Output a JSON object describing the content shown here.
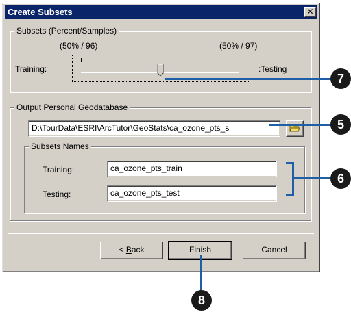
{
  "dialog": {
    "title": "Create Subsets",
    "close_glyph": "✕"
  },
  "subsets": {
    "legend": "Subsets (Percent/Samples)",
    "left_value": "(50% / 96)",
    "right_value": "(50% / 97)",
    "training_label": "Training:",
    "testing_label": ":Testing",
    "slider_fraction": 0.5
  },
  "output": {
    "legend": "Output Personal Geodatabase",
    "path": "D:\\TourData\\ESRI\\ArcTutor\\GeoStats\\ca_ozone_pts_s",
    "browse_icon": "open-folder-icon",
    "names_legend": "Subsets Names",
    "training_label": "Training:",
    "training_value": "ca_ozone_pts_train",
    "testing_label": "Testing:",
    "testing_value": "ca_ozone_pts_test"
  },
  "buttons": {
    "back_prefix": "< ",
    "back_mnemonic": "B",
    "back_rest": "ack",
    "finish": "Finish",
    "cancel": "Cancel"
  },
  "callouts": {
    "c7": "7",
    "c5": "5",
    "c6": "6",
    "c8": "8"
  },
  "colors": {
    "title_bar": "#0a246a",
    "dialog_face": "#d4d0c8",
    "callout_line": "#1f5fa8",
    "callout_circle": "#1a1a1a"
  }
}
